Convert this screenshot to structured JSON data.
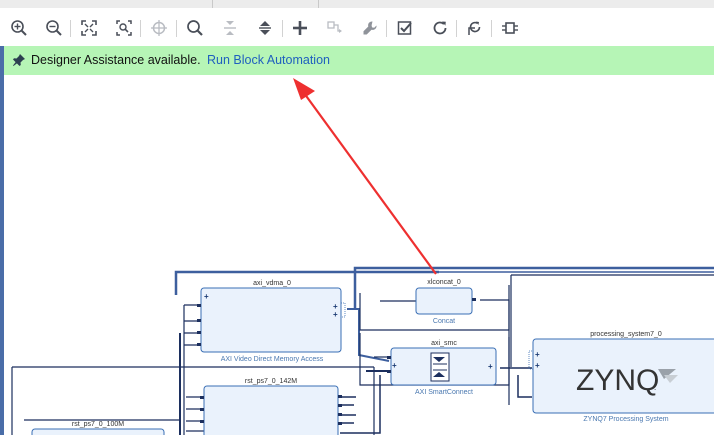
{
  "banner": {
    "message": "Designer Assistance available.",
    "link": "Run Block Automation",
    "icon": "pin-icon",
    "background": "#b6f5b6"
  },
  "toolbar": {
    "buttons": [
      {
        "name": "zoom-in-icon"
      },
      {
        "name": "zoom-out-icon"
      },
      {
        "name": "zoom-fit-icon"
      },
      {
        "name": "zoom-area-icon"
      },
      {
        "name": "center-icon"
      },
      {
        "name": "search-icon"
      },
      {
        "name": "collapse-all-icon"
      },
      {
        "name": "expand-all-icon"
      },
      {
        "name": "add-ip-icon"
      },
      {
        "name": "make-connection-icon"
      },
      {
        "name": "wrench-icon"
      },
      {
        "name": "validate-icon"
      },
      {
        "name": "refresh-icon"
      },
      {
        "name": "regenerate-layout-icon"
      },
      {
        "name": "bus-icon"
      }
    ]
  },
  "diagram": {
    "blocks": {
      "vdma": {
        "title": "axi_vdma_0",
        "subtitle": "AXI Video Direct Memory Access"
      },
      "xlconcat": {
        "title": "xlconcat_0",
        "subtitle": "Concat"
      },
      "smc": {
        "title": "axi_smc",
        "subtitle": "AXI SmartConnect"
      },
      "ps7": {
        "title": "processing_system7_0",
        "subtitle": "ZYNQ7 Processing System",
        "logo": "ZYNQ",
        "logo_suffix": "."
      },
      "rst142": {
        "title": "rst_ps7_0_142M"
      },
      "rst100": {
        "title": "rst_ps7_0_100M"
      }
    },
    "colors": {
      "block_fill": "#eaf2fc",
      "block_stroke": "#3a6fb5",
      "wire": "#1c2f5e",
      "bus": "#3d5f9e",
      "arrow": "#ee3030"
    }
  }
}
